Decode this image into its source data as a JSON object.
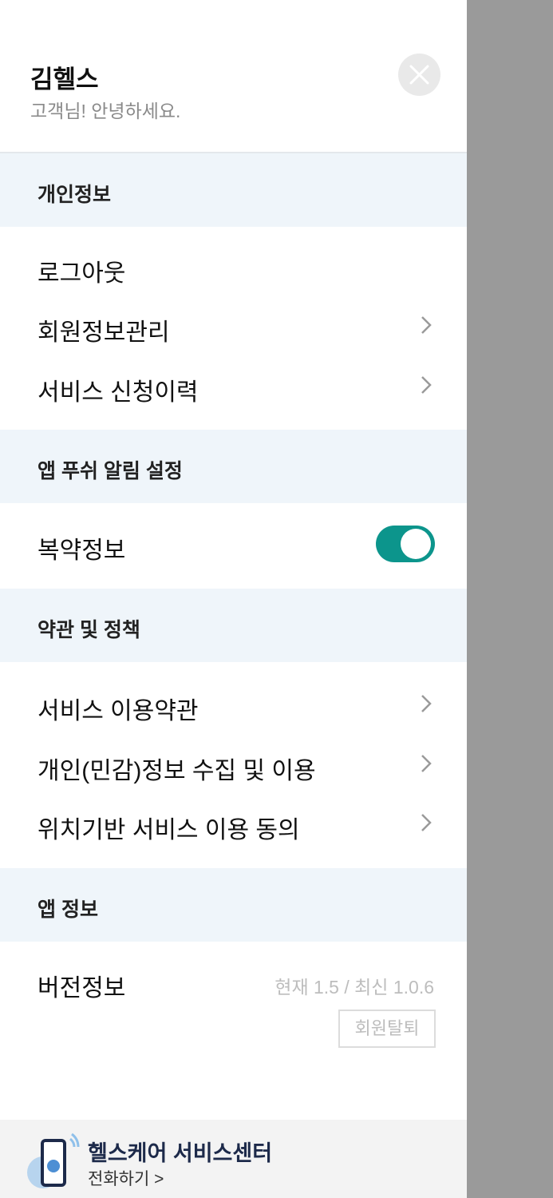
{
  "header": {
    "user_name": "김헬스",
    "greeting": "고객님! 안녕하세요."
  },
  "sections": {
    "personal": {
      "title": "개인정보",
      "items": [
        "로그아웃",
        "회원정보관리",
        "서비스 신청이력"
      ]
    },
    "push": {
      "title": "앱 푸쉬 알림 설정",
      "items": [
        "복약정보"
      ],
      "toggle_on": true
    },
    "terms": {
      "title": "약관 및 정책",
      "items": [
        "서비스 이용약관",
        "개인(민감)정보 수집 및 이용",
        "위치기반 서비스 이용 동의"
      ]
    },
    "app": {
      "title": "앱 정보",
      "items": [
        "버전정보"
      ],
      "version_text": "현재 1.5 / 최신 1.0.6",
      "withdraw_label": "회원탈퇴"
    }
  },
  "footer": {
    "title": "헬스케어 서비스센터",
    "subtitle": "전화하기 >"
  },
  "colors": {
    "accent": "#0c958c",
    "section_bg": "#eff5fa",
    "overlay": "#9a9a9a"
  }
}
